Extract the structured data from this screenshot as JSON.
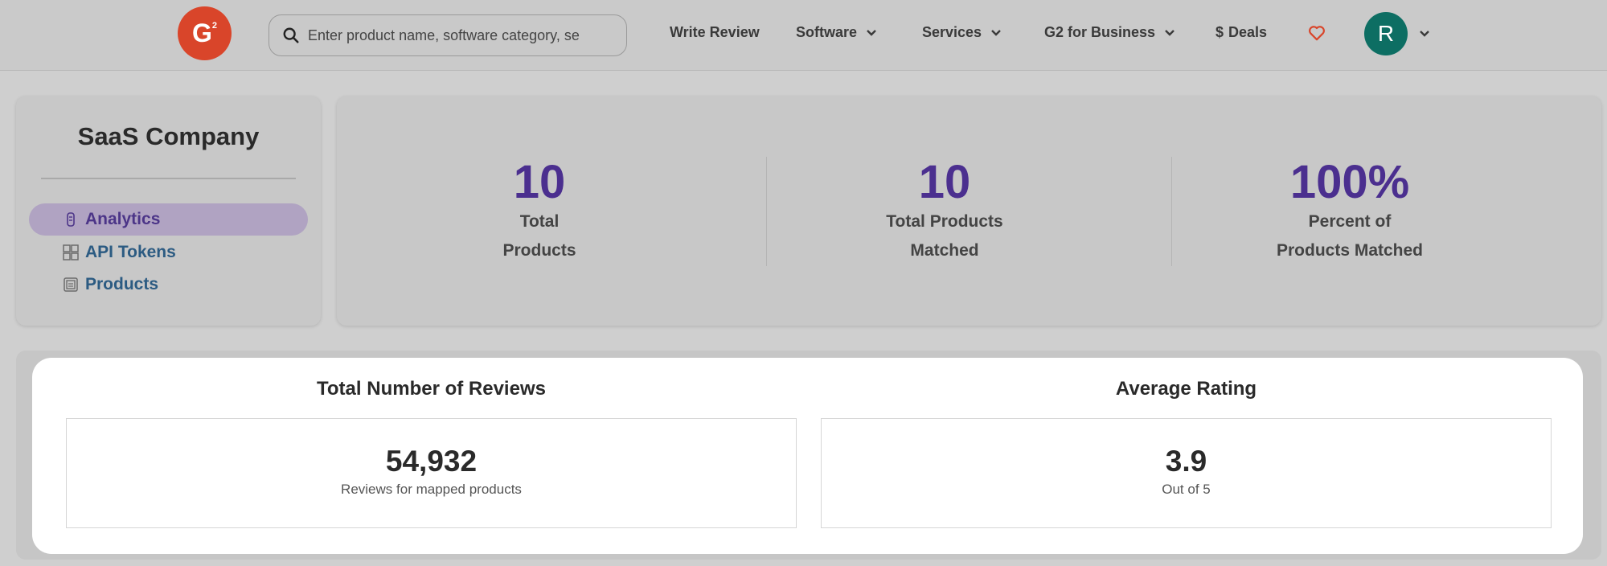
{
  "header": {
    "logo_text": "G",
    "logo_sup": "2",
    "search_placeholder": "Enter product name, software category, se",
    "nav": {
      "write_review": "Write Review",
      "software": "Software",
      "services": "Services",
      "g2_business": "G2 for Business",
      "deals_symbol": "$",
      "deals": "Deals"
    },
    "avatar_initial": "R"
  },
  "sidebar": {
    "company": "SaaS Company",
    "items": [
      {
        "label": "Analytics",
        "icon": "analytics-icon",
        "active": true
      },
      {
        "label": "API Tokens",
        "icon": "grid-icon",
        "active": false
      },
      {
        "label": "Products",
        "icon": "products-icon",
        "active": false
      }
    ]
  },
  "stats": [
    {
      "value": "10",
      "label_line1": "Total",
      "label_line2": "Products"
    },
    {
      "value": "10",
      "label_line1": "Total Products",
      "label_line2": "Matched"
    },
    {
      "value": "100%",
      "label_line1": "Percent of",
      "label_line2": "Products Matched"
    }
  ],
  "reviews": {
    "title": "Total Number of Reviews",
    "value": "54,932",
    "caption": "Reviews for mapped products"
  },
  "rating": {
    "title": "Average Rating",
    "value": "3.9",
    "caption": "Out of 5"
  },
  "colors": {
    "brand": "#d9452a",
    "accent": "#4b2f8f",
    "link": "#2c5b82",
    "avatar": "#0d6e63",
    "heart": "#d9452a"
  }
}
